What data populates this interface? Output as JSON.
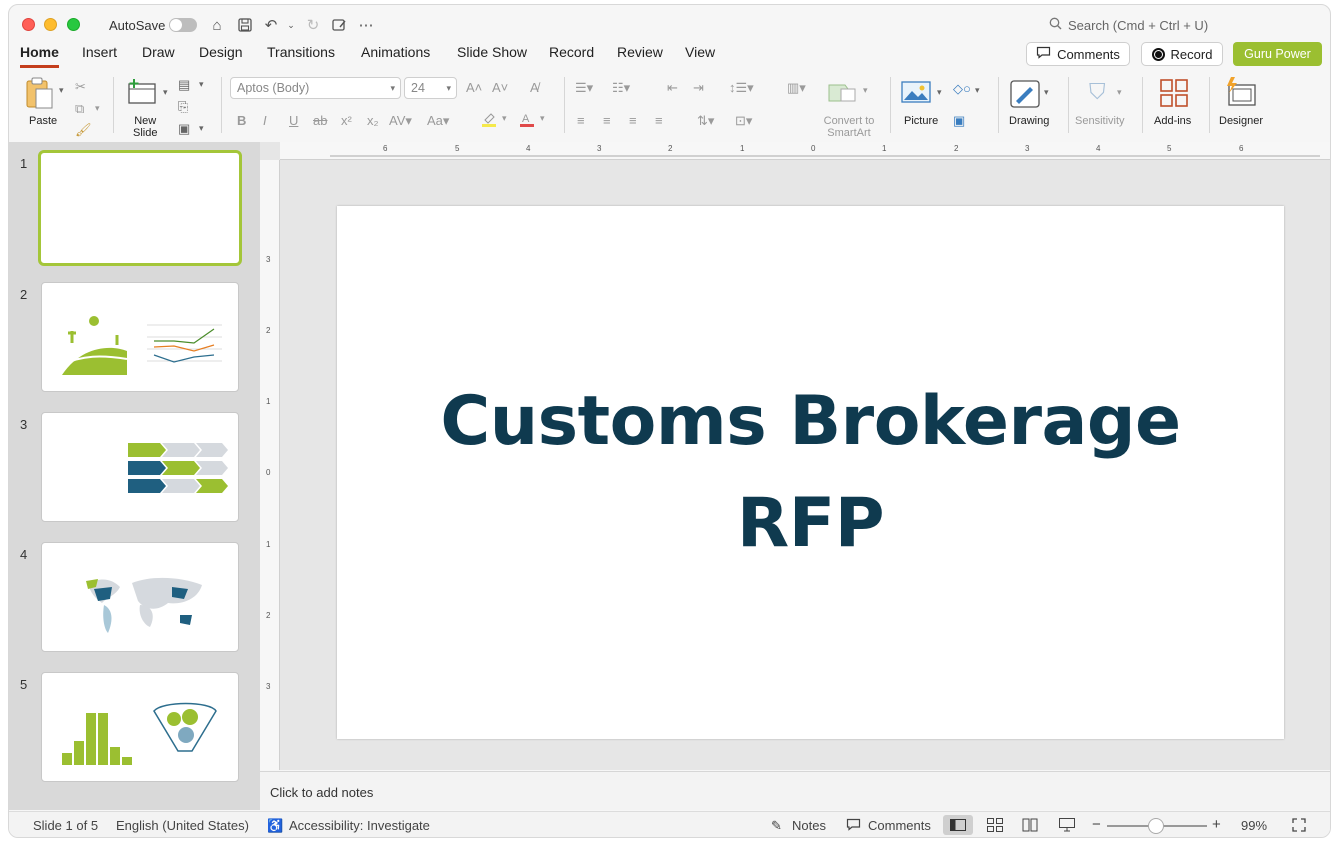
{
  "titlebar": {
    "autosave_label": "AutoSave",
    "search_placeholder": "Search (Cmd + Ctrl + U)"
  },
  "tabs": [
    "Home",
    "Insert",
    "Draw",
    "Design",
    "Transitions",
    "Animations",
    "Slide Show",
    "Record",
    "Review",
    "View"
  ],
  "actions": {
    "comments": "Comments",
    "record": "Record",
    "guru": "Guru Power"
  },
  "ribbon": {
    "paste": "Paste",
    "new_slide": "New\nSlide",
    "font_name": "Aptos (Body)",
    "font_size": "24",
    "convert_smartart": "Convert to SmartArt",
    "picture": "Picture",
    "drawing": "Drawing",
    "sensitivity": "Sensitivity",
    "addins": "Add-ins",
    "designer": "Designer"
  },
  "thumbnails": [
    {
      "num": "1"
    },
    {
      "num": "2"
    },
    {
      "num": "3"
    },
    {
      "num": "4"
    },
    {
      "num": "5"
    }
  ],
  "slide": {
    "title_line1": "Customs Brokerage",
    "title_line2": "RFP"
  },
  "notes_placeholder": "Click to add notes",
  "status": {
    "slide_count": "Slide 1 of 5",
    "language": "English (United States)",
    "accessibility": "Accessibility: Investigate",
    "notes": "Notes",
    "comments": "Comments",
    "zoom": "99%"
  },
  "colors": {
    "accent_green": "#9bbf31",
    "title_navy": "#0f3a4f",
    "tab_underline": "#c43e1c"
  }
}
